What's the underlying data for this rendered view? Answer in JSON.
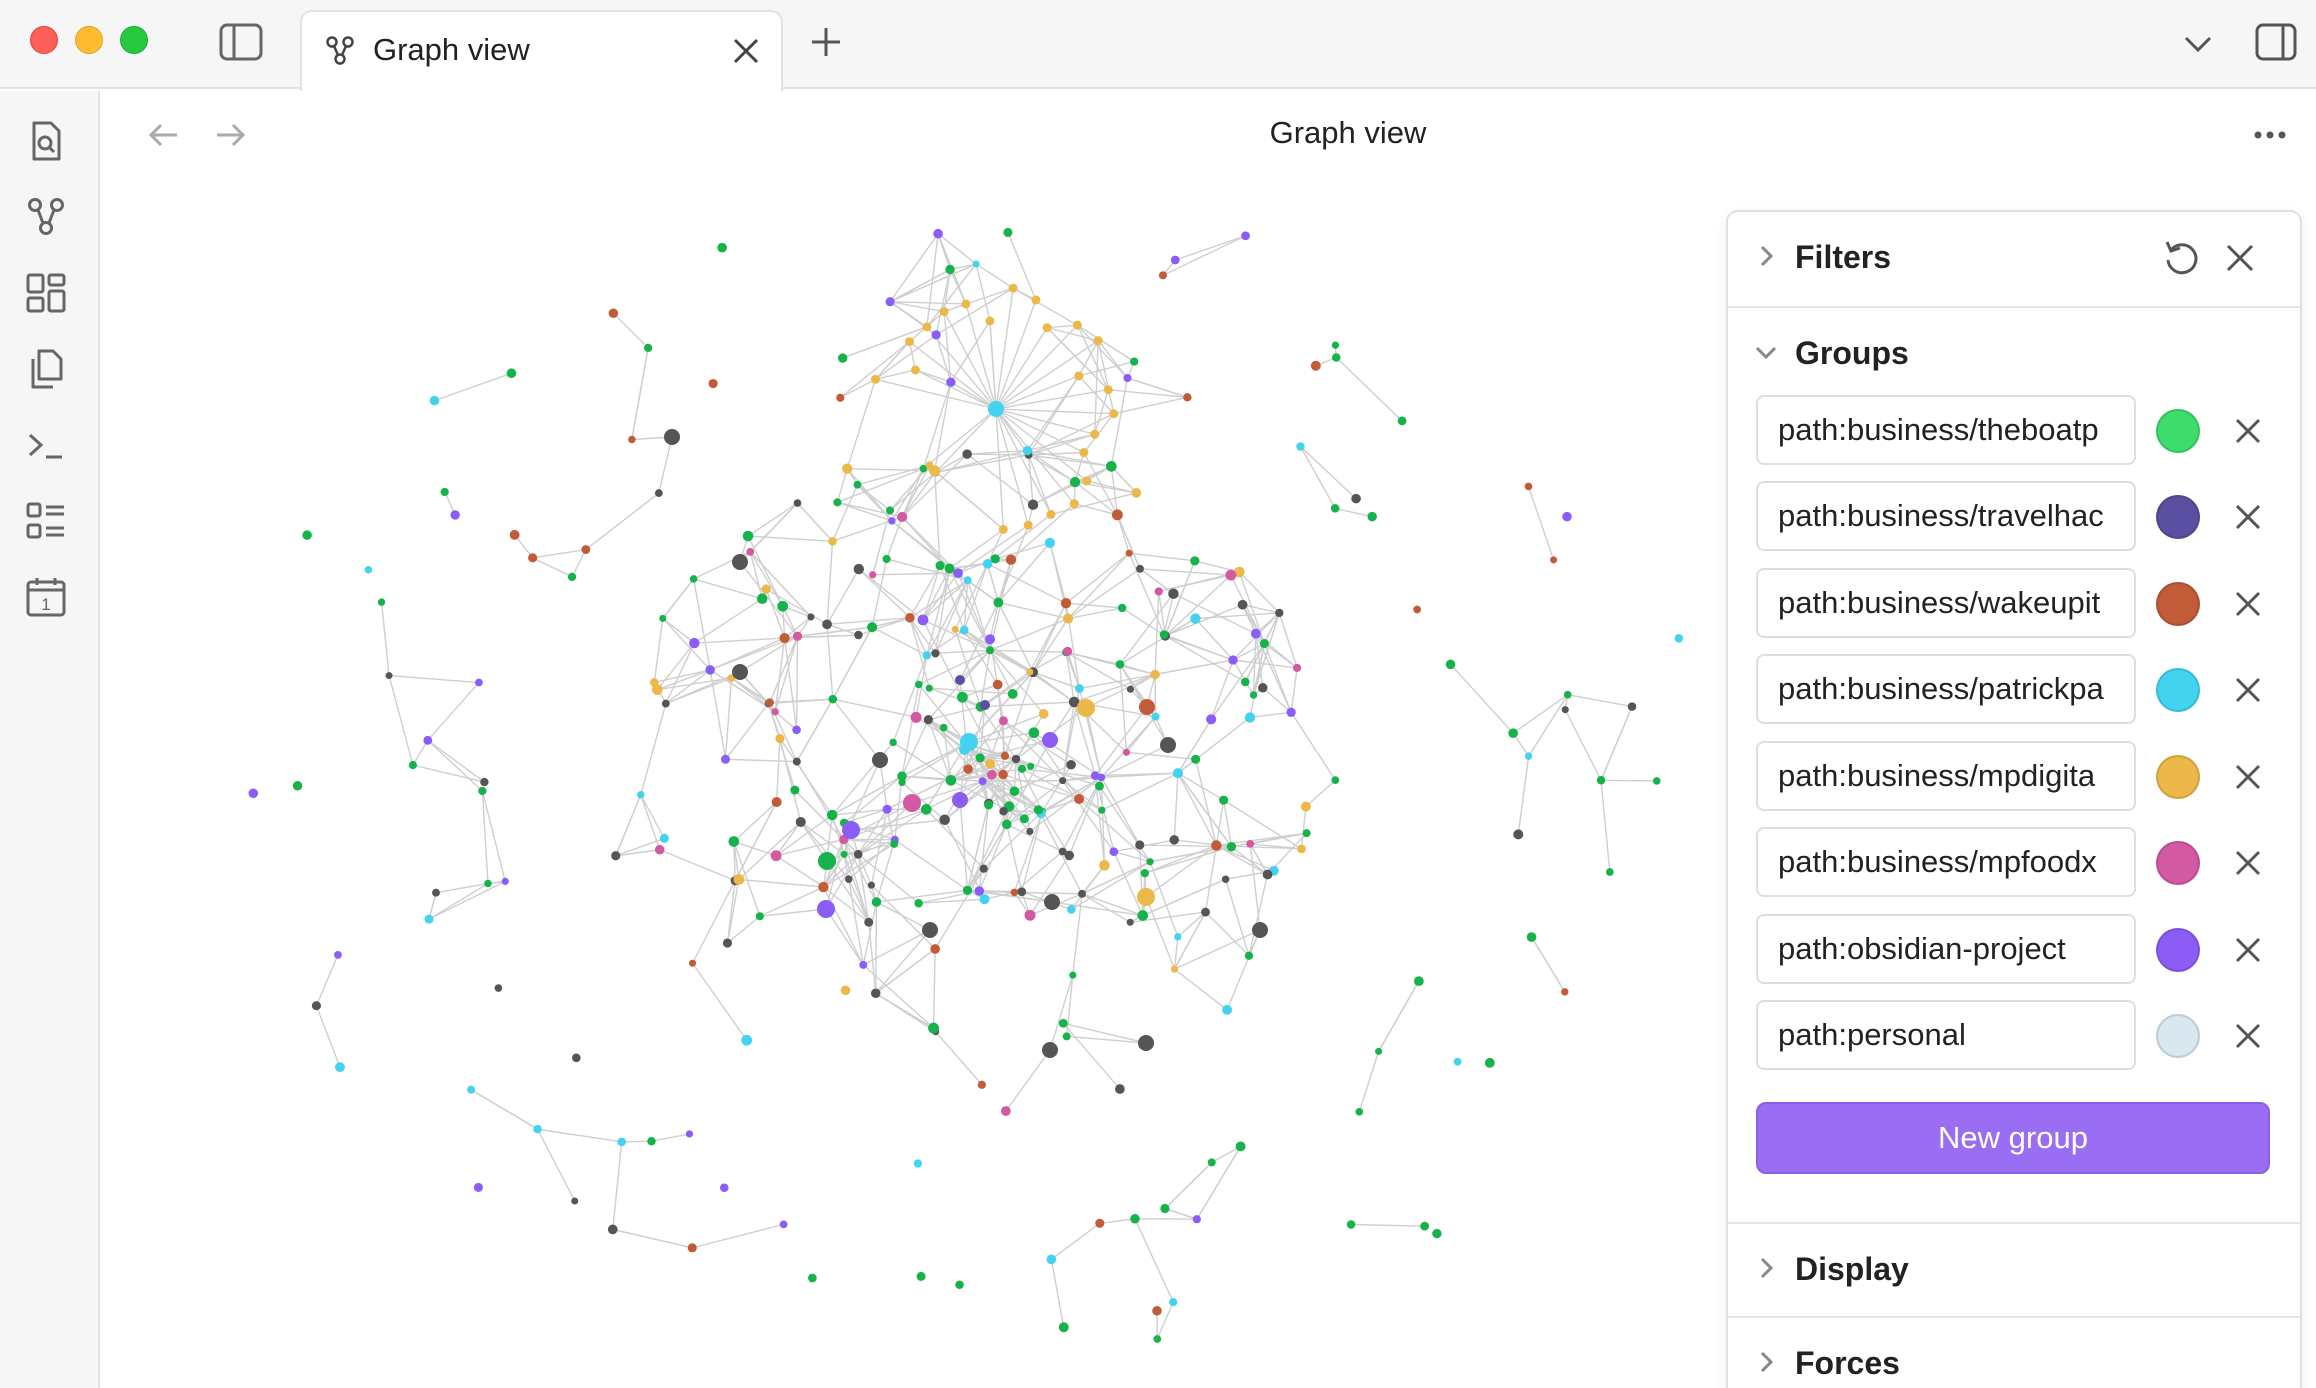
{
  "window": {
    "tab": {
      "title": "Graph view",
      "icon": "graph-icon"
    },
    "new_tab_icon": "plus-icon",
    "tab_list_icon": "chevron-down-icon",
    "sidebar_toggle_icon": "sidebar-left-icon",
    "right_sidebar_icon": "sidebar-right-icon"
  },
  "ribbon": {
    "items": [
      {
        "name": "search-file-icon"
      },
      {
        "name": "graph-icon"
      },
      {
        "name": "canvas-icon"
      },
      {
        "name": "copy-files-icon"
      },
      {
        "name": "terminal-icon"
      },
      {
        "name": "list-icon"
      },
      {
        "name": "calendar-icon",
        "label": "1"
      }
    ]
  },
  "view": {
    "title": "Graph view",
    "back_icon": "arrow-left-icon",
    "forward_icon": "arrow-right-icon",
    "more_icon": "more-horizontal-icon"
  },
  "panel": {
    "filters": {
      "label": "Filters",
      "reset_icon": "reset-icon",
      "close_icon": "close-icon"
    },
    "groups": {
      "label": "Groups",
      "items": [
        {
          "query": "path:business/theboatp",
          "color": "#3ddc6b"
        },
        {
          "query": "path:business/travelhac",
          "color": "#5a4fa0"
        },
        {
          "query": "path:business/wakeupit",
          "color": "#c25b38"
        },
        {
          "query": "path:business/patrickpa",
          "color": "#43d3ef"
        },
        {
          "query": "path:business/mpdigita",
          "color": "#ecb84a"
        },
        {
          "query": "path:business/mpfoodx",
          "color": "#d259a2"
        },
        {
          "query": "path:obsidian-project",
          "color": "#8b5cf6"
        },
        {
          "query": "path:personal",
          "color": "#d8e7f0"
        }
      ],
      "new_group_label": "New group"
    },
    "display": {
      "label": "Display"
    },
    "forces": {
      "label": "Forces"
    }
  },
  "colors": {
    "accent": "#9a6ef2",
    "node_default": "#555555",
    "link": "#cfcfcf"
  }
}
